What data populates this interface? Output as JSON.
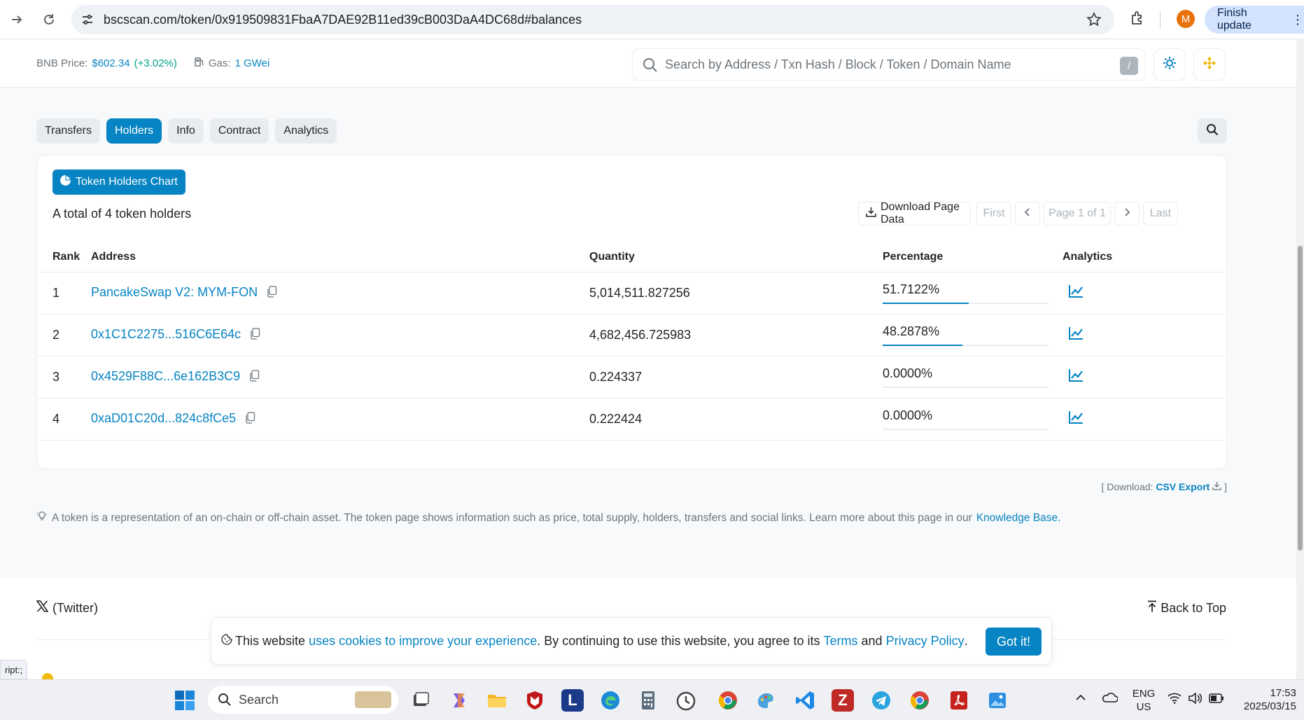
{
  "browser": {
    "url": "bscscan.com/token/0x919509831FbaA7DAE92B11ed39cB003DaA4DC68d#balances",
    "profile_initial": "M",
    "finish_update_label": "Finish update"
  },
  "header": {
    "bnb_price_label": "BNB Price:",
    "bnb_price_value": "$602.34",
    "bnb_price_change": "(+3.02%)",
    "gas_label": "Gas:",
    "gas_value": "1 GWei",
    "search_placeholder": "Search by Address / Txn Hash / Block / Token / Domain Name",
    "search_shortcut": "/"
  },
  "tabs": [
    {
      "label": "Transfers",
      "active": false
    },
    {
      "label": "Holders",
      "active": true
    },
    {
      "label": "Info",
      "active": false
    },
    {
      "label": "Contract",
      "active": false
    },
    {
      "label": "Analytics",
      "active": false
    }
  ],
  "holders": {
    "chart_button_label": "Token Holders Chart",
    "total_text": "A total of 4 token holders",
    "download_label": "Download Page Data",
    "pager_first": "First",
    "pager_page": "Page 1 of 1",
    "pager_last": "Last",
    "columns": [
      "Rank",
      "Address",
      "Quantity",
      "Percentage",
      "Analytics"
    ],
    "rows": [
      {
        "rank": "1",
        "address": "PancakeSwap V2: MYM-FON",
        "quantity": "5,014,511.827256",
        "percentage": "51.7122%",
        "pct_fraction": 0.517122
      },
      {
        "rank": "2",
        "address": "0x1C1C2275...516C6E64c",
        "quantity": "4,682,456.725983",
        "percentage": "48.2878%",
        "pct_fraction": 0.482878
      },
      {
        "rank": "3",
        "address": "0x4529F88C...6e162B3C9",
        "quantity": "0.224337",
        "percentage": "0.0000%",
        "pct_fraction": 0.0
      },
      {
        "rank": "4",
        "address": "0xaD01C20d...824c8fCe5",
        "quantity": "0.222424",
        "percentage": "0.0000%",
        "pct_fraction": 0.0
      }
    ]
  },
  "download_line": {
    "prefix": "[ Download:",
    "link": "CSV Export",
    "suffix": "]"
  },
  "info_line": {
    "text": "A token is a representation of an on-chain or off-chain asset. The token page shows information such as price, total supply, holders, transfers and social links. Learn more about this page in our",
    "link": "Knowledge Base."
  },
  "footer": {
    "twitter_label": "(Twitter)",
    "back_to_top": "Back to Top"
  },
  "cookie": {
    "part1": "This website",
    "link1": "uses cookies to improve your experience",
    "part2": ". By continuing to use this website, you agree to its",
    "link2": "Terms",
    "part3": "and",
    "link3": "Privacy Policy",
    "part4": ".",
    "button": "Got it!"
  },
  "status_url": "ript:;",
  "taskbar": {
    "search_label": "Search",
    "lang_top": "ENG",
    "lang_bottom": "US",
    "time": "17:53",
    "date": "2025/03/15"
  },
  "colors": {
    "accent": "#0784c3",
    "price_green": "#00a186"
  }
}
